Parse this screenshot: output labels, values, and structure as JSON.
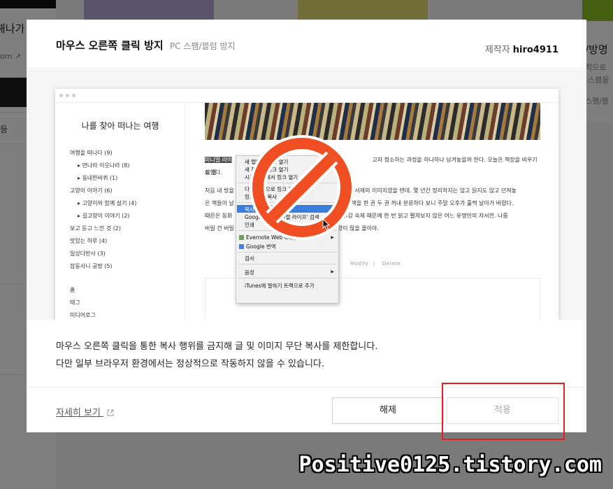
{
  "background": {
    "left_title": "해나가",
    "left_sub": "om",
    "left_item": "등",
    "right_title": "/방명",
    "right_line1": "적으로",
    "right_line2": "-스팸을",
    "right_line3": "스팸/블"
  },
  "modal": {
    "title": "마우스 오른쪽 클릭 방지",
    "subtitle": "PC 스팸/블럼 방지",
    "author_label": "제작자",
    "author_name": "hiro4911",
    "description_1": "마우스 오른쪽 클릭을 통한 복사 행위를 금지해 글 및 이미지 무단 복사를 제한합니다.",
    "description_2": "다만 일부 브라우저 환경에서는 정상적으로 작동하지 않을 수 있습니다.",
    "more_link": "자세히 보기",
    "release_button": "해제",
    "apply_button": "적용"
  },
  "preview": {
    "blog_title": "나를 찾아 떠나는 여행",
    "categories": [
      "여행을 떠나다 (9)",
      "먼나라 이웃나라 (8)",
      "동네한바퀴 (1)",
      "고양이 이야기 (6)",
      "고양이와 함께 살기 (4)",
      "길고양이 이야기 (2)",
      "보고 듣고 느낀 것 (2)",
      "맛있는 하루 (4)",
      "일상다반사 (3)",
      "잡동사니 공방 (5)"
    ],
    "nav": [
      "홈",
      "태그",
      "미디어로그"
    ],
    "para1_highlight": "미니멀 라이",
    "para1": "고자 청소하는 과정을 하나하나 남겨놓을까 한다. 오늘은 책장을 비우기로 결",
    "para1b": "심했다.",
    "para2a": "처음 내 방을",
    "para2a_r": "인 오래된 서재의 이미지였을 텐데. 몇 년간 정리하지는 않고 읽지도 않고 던져놓",
    "para2b": "은 책들이 날",
    "para2b_r": "는 기 로 책을 한 권 두 권 꺼내 분류하다 보니 주말 오후가 훌쩍 날아가 버렸다.",
    "para2c": "때문은 동화",
    "para2c_r": "진 후 후감 숙제 때문에 한 번 읽고 펼쳐보지 않은 어느 유명인의 자서전. 나름",
    "para2d": "버릴 건 버릴",
    "para2d_r": "는 양이 많을 줄이야.",
    "modify": "Modify",
    "delete": "Delete",
    "context_menu": [
      "새 탭에서 링크 열기",
      "새 창에서 링크 열기",
      "시크릿 창에서 링크 열기",
      "다른 이름으로 링크 저장...",
      "링크 주소 복사",
      "복사",
      "Google에서 '미니멀 라이프' 검색",
      "인쇄",
      "Evernote Web Clipper",
      "Google 번역",
      "검사",
      "음성",
      "iTunes에 말하기 트랙으로 추가"
    ]
  },
  "watermark": "Positive0125.tistory.com",
  "colors": {
    "highlight_box": "#e81e25",
    "ban_sign": "#f04e23",
    "menu_selection": "#3b7ddd"
  }
}
